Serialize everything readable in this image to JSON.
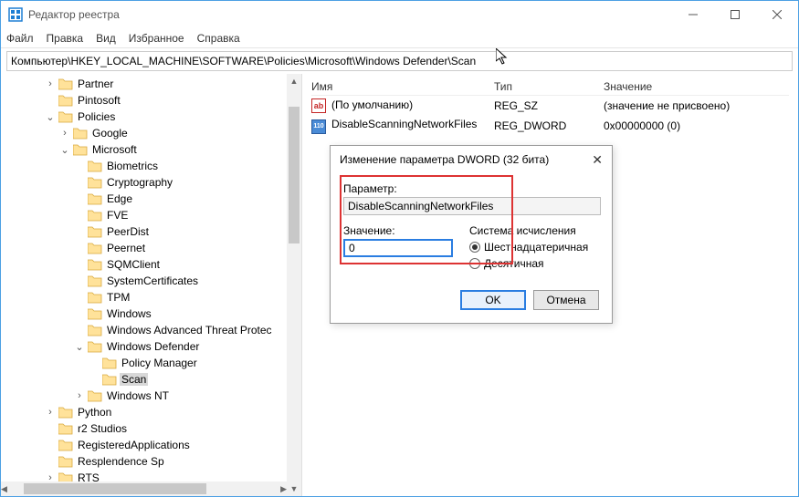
{
  "window": {
    "title": "Редактор реестра"
  },
  "menu": {
    "file": "Файл",
    "edit": "Правка",
    "view": "Вид",
    "favorites": "Избранное",
    "help": "Справка"
  },
  "address": "Компьютер\\HKEY_LOCAL_MACHINE\\SOFTWARE\\Policies\\Microsoft\\Windows Defender\\Scan",
  "tree": [
    {
      "indent": 3,
      "twisty": ">",
      "label": "Partner"
    },
    {
      "indent": 3,
      "twisty": "",
      "label": "Pintosoft"
    },
    {
      "indent": 3,
      "twisty": "v",
      "label": "Policies"
    },
    {
      "indent": 4,
      "twisty": ">",
      "label": "Google"
    },
    {
      "indent": 4,
      "twisty": "v",
      "label": "Microsoft"
    },
    {
      "indent": 5,
      "twisty": "",
      "label": "Biometrics"
    },
    {
      "indent": 5,
      "twisty": "",
      "label": "Cryptography"
    },
    {
      "indent": 5,
      "twisty": "",
      "label": "Edge"
    },
    {
      "indent": 5,
      "twisty": "",
      "label": "FVE"
    },
    {
      "indent": 5,
      "twisty": "",
      "label": "PeerDist"
    },
    {
      "indent": 5,
      "twisty": "",
      "label": "Peernet"
    },
    {
      "indent": 5,
      "twisty": "",
      "label": "SQMClient"
    },
    {
      "indent": 5,
      "twisty": "",
      "label": "SystemCertificates"
    },
    {
      "indent": 5,
      "twisty": "",
      "label": "TPM"
    },
    {
      "indent": 5,
      "twisty": "",
      "label": "Windows"
    },
    {
      "indent": 5,
      "twisty": "",
      "label": "Windows Advanced Threat Protec"
    },
    {
      "indent": 5,
      "twisty": "v",
      "label": "Windows Defender"
    },
    {
      "indent": 6,
      "twisty": "",
      "label": "Policy Manager"
    },
    {
      "indent": 6,
      "twisty": "",
      "label": "Scan",
      "selected": true
    },
    {
      "indent": 5,
      "twisty": ">",
      "label": "Windows NT"
    },
    {
      "indent": 3,
      "twisty": ">",
      "label": "Python"
    },
    {
      "indent": 3,
      "twisty": "",
      "label": "r2 Studios"
    },
    {
      "indent": 3,
      "twisty": "",
      "label": "RegisteredApplications"
    },
    {
      "indent": 3,
      "twisty": "",
      "label": "Resplendence Sp"
    },
    {
      "indent": 3,
      "twisty": ">",
      "label": "RTS"
    }
  ],
  "list": {
    "headers": {
      "name": "Имя",
      "type": "Тип",
      "value": "Значение"
    },
    "rows": [
      {
        "icon": "sz",
        "name": "(По умолчанию)",
        "type": "REG_SZ",
        "value": "(значение не присвоено)"
      },
      {
        "icon": "dw",
        "name": "DisableScanningNetworkFiles",
        "type": "REG_DWORD",
        "value": "0x00000000 (0)"
      }
    ]
  },
  "dialog": {
    "title": "Изменение параметра DWORD (32 бита)",
    "param_label": "Параметр:",
    "param_value": "DisableScanningNetworkFiles",
    "value_label": "Значение:",
    "value_value": "0",
    "base_label": "Система исчисления",
    "radio_hex": "Шестнадцатеричная",
    "radio_dec": "Десятичная",
    "ok": "OK",
    "cancel": "Отмена"
  }
}
